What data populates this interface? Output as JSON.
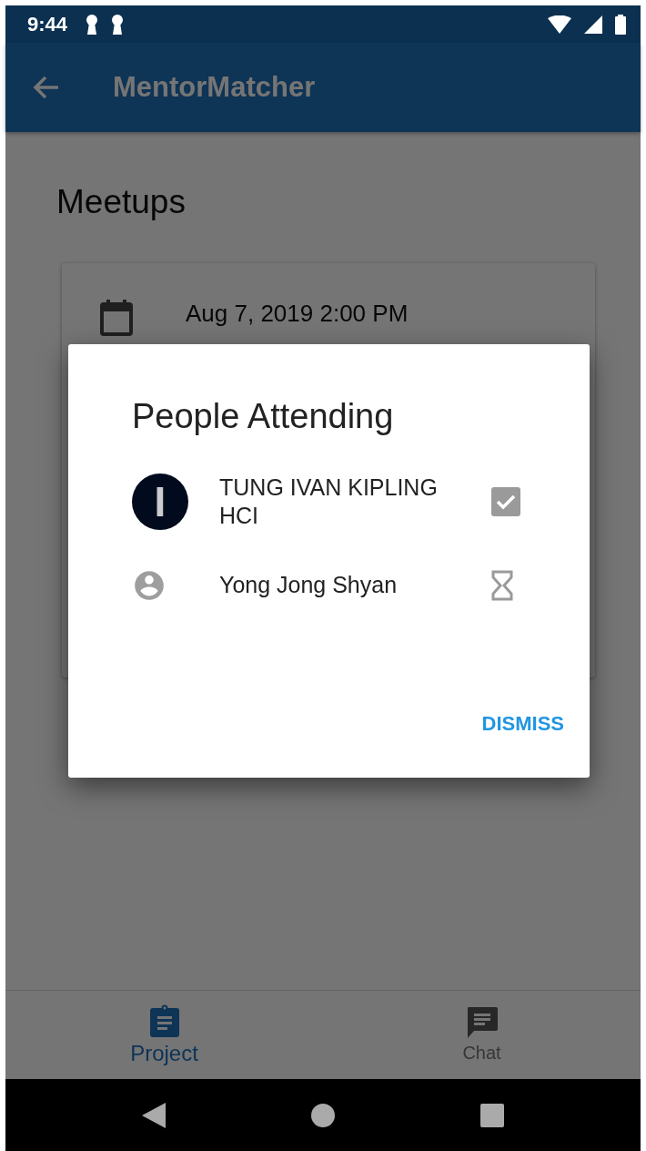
{
  "status_bar": {
    "time": "9:44"
  },
  "app_bar": {
    "title": "MentorMatcher"
  },
  "page": {
    "heading": "Meetups",
    "meetup": {
      "date": "Aug 7, 2019 2:00 PM"
    }
  },
  "dialog": {
    "title": "People Attending",
    "attendees": [
      {
        "name": "TUNG IVAN KIPLING HCI",
        "avatar": {
          "kind": "initial",
          "initial": "I"
        },
        "confirmed": true
      },
      {
        "name": "Yong Jong Shyan",
        "avatar": {
          "kind": "icon"
        },
        "confirmed": false
      }
    ],
    "action": "DISMISS"
  },
  "bottom_nav": [
    {
      "label": "Project",
      "kind": "project",
      "selected": true
    },
    {
      "label": "Chat",
      "kind": "chat",
      "selected": false
    }
  ]
}
